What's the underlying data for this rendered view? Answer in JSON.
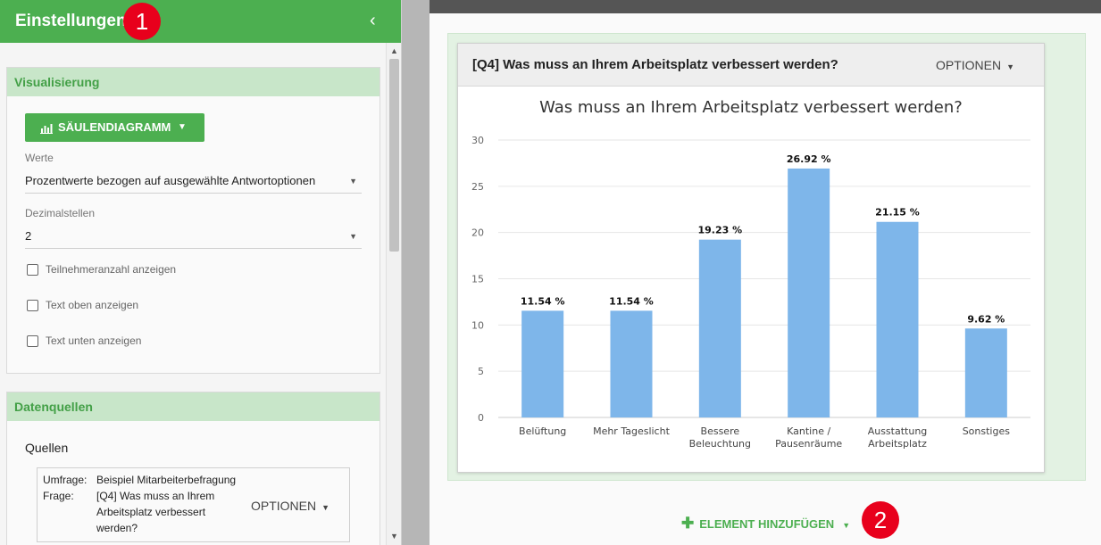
{
  "panel": {
    "title": "Einstellungen",
    "badge": "1",
    "collapse_icon": "‹"
  },
  "visualisierung": {
    "heading": "Visualisierung",
    "chart_type_button": "SÄULENDIAGRAMM",
    "werte_label": "Werte",
    "werte_value": "Prozentwerte bezogen auf ausgewählte Antwortoptionen",
    "dezimal_label": "Dezimalstellen",
    "dezimal_value": "2",
    "checkboxes": [
      {
        "label": "Teilnehmeranzahl anzeigen",
        "checked": false
      },
      {
        "label": "Text oben anzeigen",
        "checked": false
      },
      {
        "label": "Text unten anzeigen",
        "checked": false
      }
    ]
  },
  "datenquellen": {
    "heading": "Datenquellen",
    "sources_label": "Quellen",
    "umfrage_key": "Umfrage:",
    "umfrage_value": "Beispiel Mitarbeiterbefragung",
    "frage_key": "Frage:",
    "frage_value": "[Q4] Was muss an Ihrem Arbeitsplatz verbessert werden?",
    "options_label": "OPTIONEN"
  },
  "element": {
    "header_title": "[Q4] Was muss an Ihrem Arbeitsplatz verbessert werden?",
    "options_label": "OPTIONEN"
  },
  "add_element_label": "ELEMENT HINZUFÜGEN",
  "badge2": "2",
  "colors": {
    "green": "#4caf50",
    "light_green": "#c8e6c9",
    "bar": "#7eb6ea",
    "badge": "#e8001c"
  },
  "chart_data": {
    "type": "bar",
    "title": "Was muss an Ihrem Arbeitsplatz verbessert werden?",
    "categories": [
      [
        "Belüftung"
      ],
      [
        "Mehr Tageslicht"
      ],
      [
        "Bessere",
        "Beleuchtung"
      ],
      [
        "Kantine /",
        "Pausenräume"
      ],
      [
        "Ausstattung",
        "Arbeitsplatz"
      ],
      [
        "Sonstiges"
      ]
    ],
    "values": [
      11.54,
      11.54,
      19.23,
      26.92,
      21.15,
      9.62
    ],
    "data_labels": [
      "11.54 %",
      "11.54 %",
      "19.23 %",
      "26.92 %",
      "21.15 %",
      "9.62 %"
    ],
    "yticks": [
      0,
      5,
      10,
      15,
      20,
      25,
      30
    ],
    "ylim": [
      0,
      30
    ],
    "grid": true,
    "xlabel": "",
    "ylabel": ""
  }
}
